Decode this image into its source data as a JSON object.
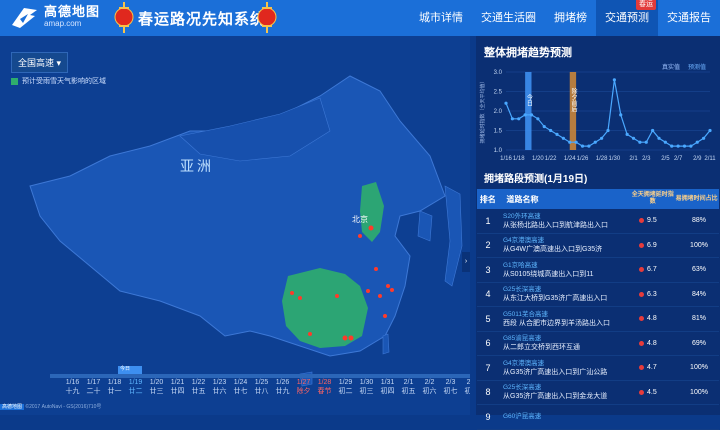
{
  "header": {
    "logo_cn": "高德地图",
    "logo_en": "amap.com",
    "title": "春运路况先知系统",
    "nav": [
      {
        "label": "城市详情"
      },
      {
        "label": "交通生活圈"
      },
      {
        "label": "拥堵榜"
      },
      {
        "label": "交通预测",
        "badge": "春运",
        "active": true
      },
      {
        "label": "交通报告"
      }
    ]
  },
  "map": {
    "region_select": "全国高速",
    "legend": "预计受雨雪天气影响的区域",
    "label_asia": "亚洲",
    "label_beijing": "北京",
    "copyright": "©2017 AutoNavi - GS(2016)710号",
    "copyright_logo": "高德地图",
    "timeline_current": "今日",
    "timeline": [
      {
        "d": "1/16",
        "l": "十九"
      },
      {
        "d": "1/17",
        "l": "二十"
      },
      {
        "d": "1/18",
        "l": "廿一"
      },
      {
        "d": "1/19",
        "l": "廿二"
      },
      {
        "d": "1/20",
        "l": "廿三"
      },
      {
        "d": "1/21",
        "l": "廿四"
      },
      {
        "d": "1/22",
        "l": "廿五"
      },
      {
        "d": "1/23",
        "l": "廿六"
      },
      {
        "d": "1/24",
        "l": "廿七"
      },
      {
        "d": "1/25",
        "l": "廿八"
      },
      {
        "d": "1/26",
        "l": "廿九"
      },
      {
        "d": "1/27",
        "l": "除夕"
      },
      {
        "d": "1/28",
        "l": "春节"
      },
      {
        "d": "1/29",
        "l": "初二"
      },
      {
        "d": "1/30",
        "l": "初三"
      },
      {
        "d": "1/31",
        "l": "初四"
      },
      {
        "d": "2/1",
        "l": "初五"
      },
      {
        "d": "2/2",
        "l": "初六"
      },
      {
        "d": "2/3",
        "l": "初七"
      },
      {
        "d": "2/4",
        "l": "初八"
      }
    ]
  },
  "panel": {
    "trend_title": "整体拥堵趋势预测",
    "real_label": "真实值",
    "pred_label": "预测值",
    "section_title": "拥堵路段预测(1月19日)",
    "table_headers": {
      "rank": "排名",
      "road": "道路名称",
      "idx": "全天拥堵延时指数",
      "pct": "易拥堵时间占比"
    },
    "rows": [
      {
        "rank": "1",
        "code": "S20外环高速",
        "desc": "从张杨北路出入口到航津路出入口",
        "idx": "9.5",
        "pct": "88%"
      },
      {
        "rank": "2",
        "code": "G4京港澳高速",
        "desc": "从G4W广澳高速出入口到G35济",
        "idx": "6.9",
        "pct": "100%"
      },
      {
        "rank": "3",
        "code": "G1京哈高速",
        "desc": "从S0105绕城高速出入口到11",
        "idx": "6.7",
        "pct": "63%"
      },
      {
        "rank": "4",
        "code": "G25长深高速",
        "desc": "从东江大桥到G35济广高速出入口",
        "idx": "6.3",
        "pct": "84%"
      },
      {
        "rank": "5",
        "code": "G5011芜合高速",
        "desc": "西段 从合肥市边界到羊汤路出入口",
        "idx": "4.8",
        "pct": "81%"
      },
      {
        "rank": "6",
        "code": "G85渝昆高速",
        "desc": "从二郎立交桥到西环互通",
        "idx": "4.8",
        "pct": "69%"
      },
      {
        "rank": "7",
        "code": "G4京港澳高速",
        "desc": "从G35济广高速出入口到广汕公路",
        "idx": "4.7",
        "pct": "100%"
      },
      {
        "rank": "8",
        "code": "G25长深高速",
        "desc": "从G35济广高速出入口到金龙大道",
        "idx": "4.5",
        "pct": "100%"
      },
      {
        "rank": "9",
        "code": "G60沪昆高速",
        "desc": "",
        "idx": "",
        "pct": ""
      }
    ]
  },
  "chart_data": {
    "type": "line",
    "title": "",
    "ylabel": "拥堵延时指数（全天平均值）",
    "ylim": [
      1.0,
      3.0
    ],
    "yticks": [
      1.0,
      1.5,
      2.0,
      2.5,
      3.0
    ],
    "xticks": [
      "1/16",
      "1/18",
      "1/20",
      "1/22",
      "1/24",
      "1/26",
      "1/28",
      "1/30",
      "2/1",
      "2/3",
      "2/5",
      "2/7",
      "2/9",
      "2/11"
    ],
    "bands": [
      {
        "label": "今日",
        "from": 3,
        "to": 4,
        "color": "#3d8ff0"
      },
      {
        "label": "除夕前后",
        "from": 10,
        "to": 11,
        "color": "#c8853a"
      }
    ],
    "series": [
      {
        "values": [
          2.2,
          1.8,
          1.8,
          1.9,
          1.9,
          1.8,
          1.6,
          1.5,
          1.4,
          1.3,
          1.2,
          1.2,
          1.1,
          1.1,
          1.2,
          1.3,
          1.5,
          2.8,
          1.9,
          1.4,
          1.3,
          1.2,
          1.2,
          1.5,
          1.3,
          1.2,
          1.1,
          1.1,
          1.1,
          1.1,
          1.2,
          1.3,
          1.5
        ]
      }
    ]
  }
}
